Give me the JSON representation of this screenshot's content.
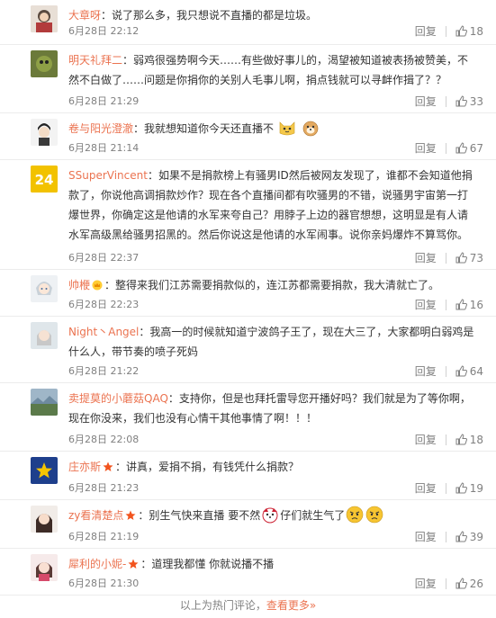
{
  "comments": [
    {
      "user": "大章呀",
      "text": "：说了那么多，我只想说不直播的都是垃圾。",
      "date": "6月28日 22:12",
      "reply": "回复",
      "likes": "18"
    },
    {
      "user": "明天礼拜二",
      "text": "：弱鸡很强势啊今天……有些做好事儿的，渴望被知道被表扬被赞美，不然不白做了……问题是你捐你的关别人毛事儿啊，捐点钱就可以寻衅作揖了？？",
      "date": "6月28日 21:29",
      "reply": "回复",
      "likes": "33"
    },
    {
      "user": "卷与阳光澄澈",
      "text": "：我就想知道你今天还直播不",
      "date": "6月28日 21:14",
      "reply": "回复",
      "likes": "67"
    },
    {
      "user": "SSuperVincent",
      "text": "：如果不是捐款榜上有骚男ID然后被网友发现了，谁都不会知道他捐款了，你说他高调捐款炒作？现在各个直播间都有吹骚男的不错，说骚男宇宙第一打爆世界，你确定这是他请的水军来夸自己？用脖子上边的器官想想，这明显是有人请水军高级黑给骚男招黑的。然后你说这是他请的水军闹事。说你亲妈爆炸不算骂你。",
      "date": "6月28日 22:37",
      "reply": "回复",
      "likes": "73"
    },
    {
      "user": "帅楩",
      "text": "：整得来我们江苏需要捐款似的，连江苏都需要捐款，我大清就亡了。",
      "date": "6月28日 22:23",
      "reply": "回复",
      "likes": "16"
    },
    {
      "user": "Night丶Angel",
      "text": "：我高一的时候就知道宁波鸽子王了，现在大三了，大家都明白弱鸡是什么人，带节奏的喷子死妈",
      "date": "6月28日 21:22",
      "reply": "回复",
      "likes": "64"
    },
    {
      "user": "卖提莫的小蘑菇QAQ",
      "text": "：支持你，但是也拜托雷导您开播好吗？我们就是为了等你啊，现在你没来，我们也没有心情干其他事情了啊！！！",
      "date": "6月28日 22:08",
      "reply": "回复",
      "likes": "18"
    },
    {
      "user": "庄亦斯",
      "text": "：讲真，爱捐不捐，有钱凭什么捐款？",
      "date": "6月28日 21:23",
      "reply": "回复",
      "likes": "19"
    },
    {
      "user": "zy看清楚点",
      "text": "：别生气快来直播 要不然",
      "text2": "仔们就生气了",
      "date": "6月28日 21:19",
      "reply": "回复",
      "likes": "39"
    },
    {
      "user": "犀利的小妮-",
      "text": "：道理我都懂 你就说播不播",
      "date": "6月28日 21:30",
      "reply": "回复",
      "likes": "26"
    }
  ],
  "footer": {
    "prefix": "以上为热门评论，",
    "more": "查看更多",
    "suffix": "»"
  },
  "colors": {
    "username": "#eb7350",
    "meta": "#808080",
    "text": "#333333"
  }
}
